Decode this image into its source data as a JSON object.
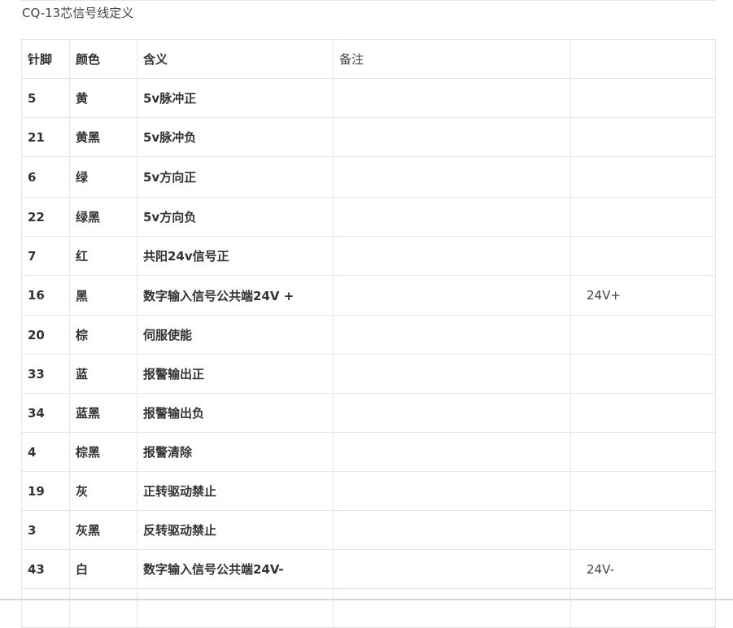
{
  "title": "CQ-13芯信号线定义",
  "table": {
    "header": {
      "pin": "针脚",
      "color": "颜色",
      "meaning": "含义",
      "remark": "备注",
      "extra": ""
    },
    "rows": [
      {
        "pin": "5",
        "color": "黄",
        "meaning": "5v脉冲正",
        "remark": "",
        "extra": ""
      },
      {
        "pin": "21",
        "color": "黄黑",
        "meaning": "5v脉冲负",
        "remark": "",
        "extra": ""
      },
      {
        "pin": "6",
        "color": "绿",
        "meaning": "5v方向正",
        "remark": "",
        "extra": ""
      },
      {
        "pin": "22",
        "color": "绿黑",
        "meaning": "5v方向负",
        "remark": "",
        "extra": ""
      },
      {
        "pin": "7",
        "color": "红",
        "meaning": "共阳24v信号正",
        "remark": "",
        "extra": ""
      },
      {
        "pin": "16",
        "color": "黑",
        "meaning": "数字输入信号公共端24V +",
        "remark": "",
        "extra": "24V+"
      },
      {
        "pin": "20",
        "color": "棕",
        "meaning": "伺服使能",
        "remark": "",
        "extra": ""
      },
      {
        "pin": "33",
        "color": "蓝",
        "meaning": "报警输出正",
        "remark": "",
        "extra": ""
      },
      {
        "pin": "34",
        "color": "蓝黑",
        "meaning": "报警输出负",
        "remark": "",
        "extra": ""
      },
      {
        "pin": "4",
        "color": "棕黑",
        "meaning": "报警清除",
        "remark": "",
        "extra": ""
      },
      {
        "pin": "19",
        "color": "灰",
        "meaning": "正转驱动禁止",
        "remark": "",
        "extra": ""
      },
      {
        "pin": "3",
        "color": "灰黑",
        "meaning": "反转驱动禁止",
        "remark": "",
        "extra": ""
      },
      {
        "pin": "43",
        "color": "白",
        "meaning": "数字输入信号公共端24V-",
        "remark": "",
        "extra": "24V-"
      },
      {
        "pin": "",
        "color": "",
        "meaning": "",
        "remark": "",
        "extra": ""
      }
    ]
  }
}
